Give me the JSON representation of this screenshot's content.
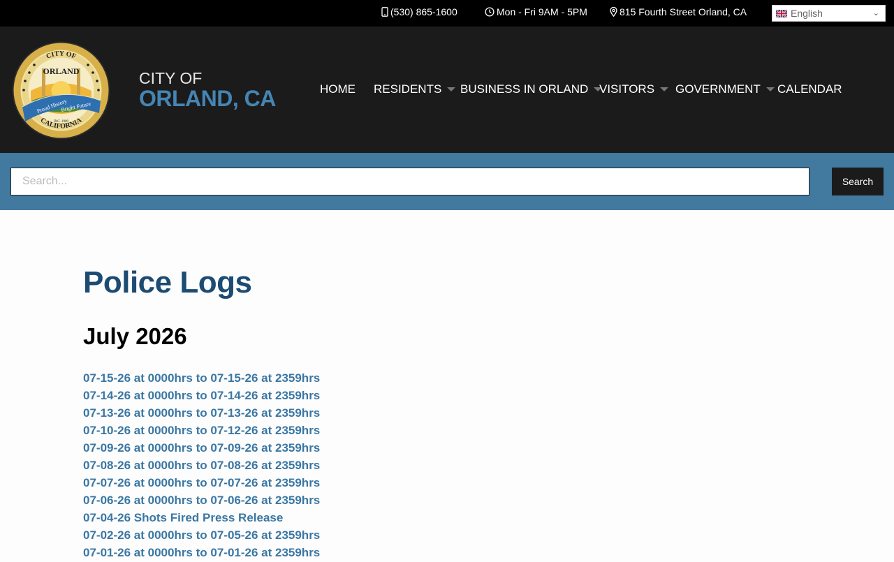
{
  "topbar": {
    "phone": "(530) 865-1600",
    "hours": "Mon - Fri 9AM - 5PM",
    "address": "815 Fourth Street Orland, CA",
    "language": "English",
    "icons": {
      "phone": "mobile-phone-icon",
      "hours": "clock-icon",
      "address": "map-pin-icon",
      "flag": "uk-flag-icon",
      "dropdown": "chevron-down-icon"
    }
  },
  "header": {
    "logo": {
      "top": "CITY OF",
      "name": "ORLAND",
      "motto_1": "Proud History",
      "motto_2": "Bright Future",
      "inc": "INC. 1909",
      "state": "CALIFORNIA"
    },
    "brand_line1": "CITY OF",
    "brand_line2": "ORLAND, CA",
    "nav": [
      "HOME",
      "RESIDENTS",
      "BUSINESS IN ORLAND",
      "VISITORS",
      "GOVERNMENT",
      "CALENDAR"
    ]
  },
  "search": {
    "placeholder": "Search...",
    "button": "Search"
  },
  "main": {
    "title": "Police Logs",
    "month": "July 2026",
    "logs": [
      "07-15-26 at 0000hrs to 07-15-26 at 2359hrs",
      "07-14-26 at 0000hrs to 07-14-26 at 2359hrs",
      "07-13-26 at 0000hrs to 07-13-26 at 2359hrs",
      "07-10-26 at 0000hrs to 07-12-26 at 2359hrs",
      "07-09-26 at 0000hrs to 07-09-26 at 2359hrs",
      "07-08-26 at 0000hrs to 07-08-26 at 2359hrs",
      "07-07-26 at 0000hrs to 07-07-26 at 2359hrs",
      "07-06-26 at 0000hrs to 07-06-26 at 2359hrs",
      "07-04-26 Shots Fired Press Release",
      "07-02-26 at 0000hrs to 07-05-26 at 2359hrs",
      "07-01-26 at 0000hrs to 07-01-26 at 2359hrs"
    ]
  },
  "colors": {
    "topbar": "#000000",
    "header": "#1b1b1b",
    "accent": "#42799f",
    "title": "#1c4b73",
    "link": "#3a77a3"
  }
}
